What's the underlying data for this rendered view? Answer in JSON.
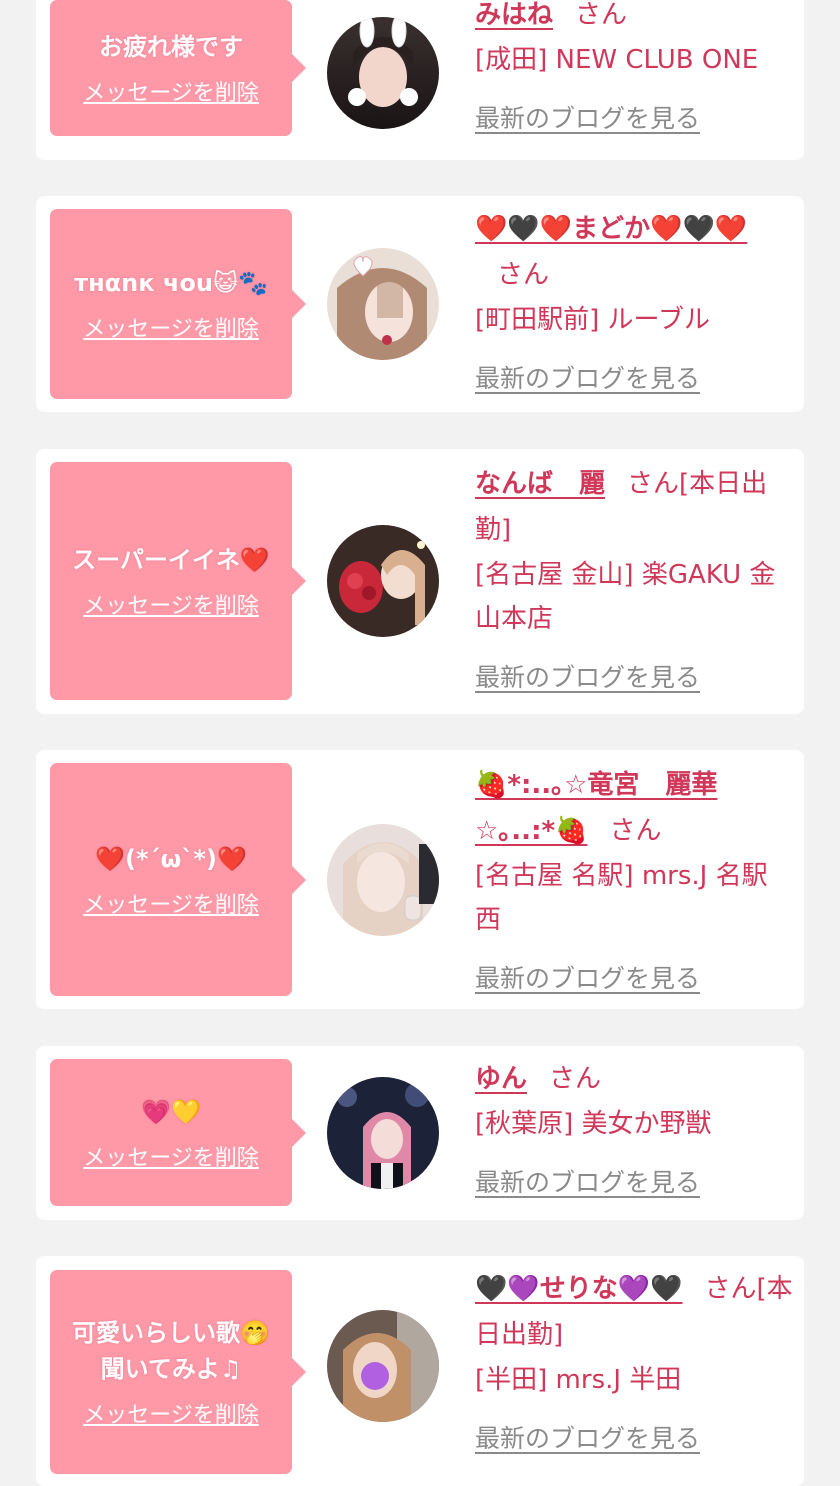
{
  "delete_label": "メッセージを削除",
  "blog_label": "最新のブログを見る",
  "honorific": "さん",
  "colors": {
    "background": "#f2f2f2",
    "bubble": "#ff99a8",
    "accent": "#d0385a",
    "link_gray": "#8a8a8a"
  },
  "items": [
    {
      "message": "お疲れ様です",
      "name": "みはね",
      "shift": "",
      "place": "[成田] NEW CLUB ONE"
    },
    {
      "message": "тнαnк чou😺🐾",
      "name": "❤️🖤❤️まどか❤️🖤❤️",
      "shift": "",
      "place": "[町田駅前] ルーブル"
    },
    {
      "message": "スーパーイイネ❤️",
      "name": "なんば　麗",
      "shift": "[本日出勤]",
      "place": "[名古屋 金山] 楽GAKU 金山本店"
    },
    {
      "message": "❤️(*´ω`*)❤️",
      "name": "🍓*:..｡☆竜宮　麗華☆｡..:*🍓",
      "shift": "",
      "place": "[名古屋 名駅] mrs.J 名駅西"
    },
    {
      "message": "💗💛",
      "name": "ゆん",
      "shift": "",
      "place": "[秋葉原] 美女か野獣"
    },
    {
      "message": "可愛いらしい歌🤭聞いてみよ♫",
      "name": "🖤💜せりな💜🖤",
      "shift": "[本日出勤]",
      "place": "[半田] mrs.J 半田"
    }
  ]
}
